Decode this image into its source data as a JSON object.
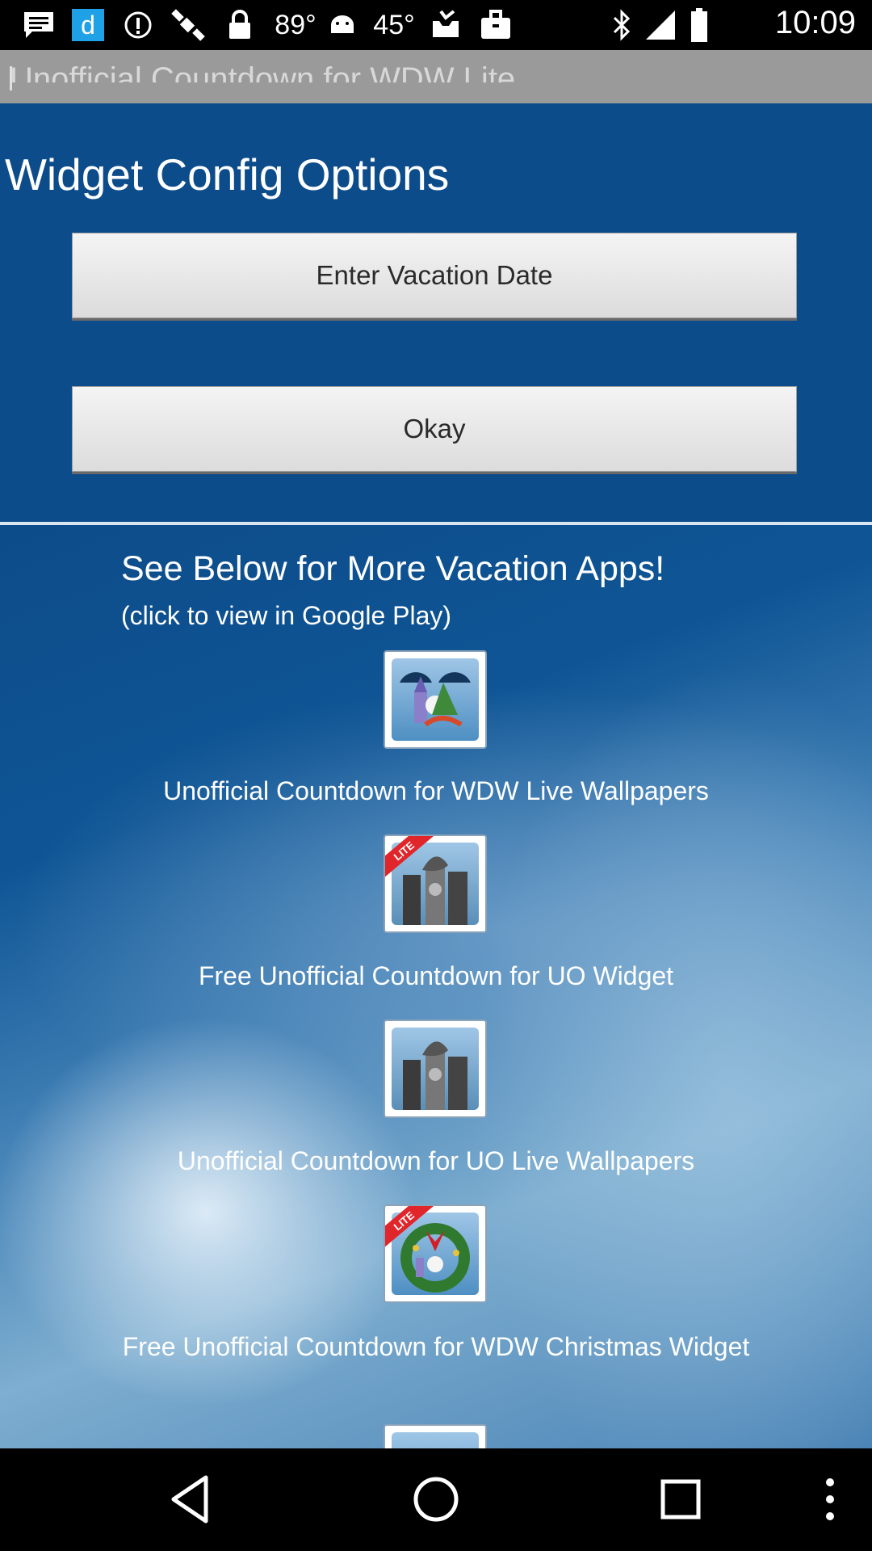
{
  "status_bar": {
    "time": "10:09",
    "temp1": "89°",
    "temp2": "45°",
    "icons": [
      "message-icon",
      "dictionary-app-icon",
      "info-icon",
      "fake-gps-icon",
      "lock-icon",
      "android-icon",
      "inbox-icon",
      "briefcase-icon",
      "bluetooth-icon",
      "signal-icon",
      "battery-icon"
    ]
  },
  "title_bar": {
    "title": "Unofficial Countdown for WDW Lite"
  },
  "config": {
    "heading": "Widget Config Options",
    "date_button": "Enter Vacation Date",
    "okay_button": "Okay"
  },
  "apps": {
    "heading": "See Below for More Vacation Apps!",
    "subheading": "(click to view in Google Play)",
    "items": [
      {
        "label": "Unofficial Countdown for WDW Live Wallpapers",
        "icon": "castle-app-icon",
        "lite": false
      },
      {
        "label": "Free Unofficial Countdown for UO Widget",
        "icon": "tower-app-icon",
        "lite": true
      },
      {
        "label": "Unofficial Countdown for UO Live Wallpapers",
        "icon": "tower-app-icon",
        "lite": false
      },
      {
        "label": "Free Unofficial Countdown for WDW Christmas Widget",
        "icon": "wreath-app-icon",
        "lite": true
      }
    ],
    "lite_ribbon": "LITE"
  },
  "nav_bar": {
    "buttons": [
      "back-icon",
      "home-icon",
      "recents-icon",
      "more-options-icon"
    ]
  },
  "colors": {
    "panel_blue": "#0d4c8a",
    "button_gray": "#e8e8e8",
    "title_bar_gray": "#9a9a9a"
  }
}
